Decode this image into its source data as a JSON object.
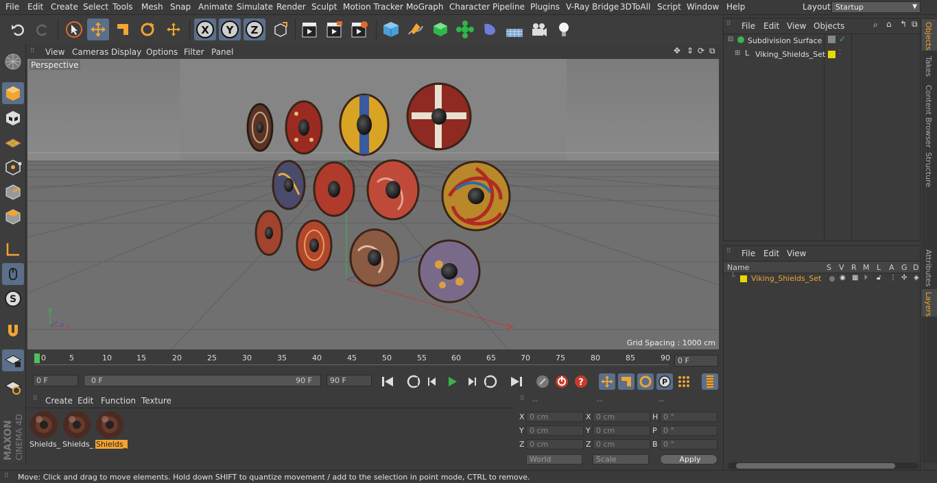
{
  "menu": [
    "File",
    "Edit",
    "Create",
    "Select",
    "Tools",
    "Mesh",
    "Snap",
    "Animate",
    "Simulate",
    "Render",
    "Sculpt",
    "Motion Tracker",
    "MoGraph",
    "Character",
    "Pipeline",
    "Plugins",
    "V-Ray Bridge",
    "3DToAll",
    "Script",
    "Window",
    "Help"
  ],
  "layout": {
    "label": "Layout:",
    "value": "Startup"
  },
  "viewport": {
    "menu": [
      "View",
      "Cameras",
      "Display",
      "Options",
      "Filter",
      "Panel"
    ],
    "label": "Perspective",
    "grid_spacing": "Grid Spacing : 1000 cm"
  },
  "timeline": {
    "ticks": [
      "0",
      "5",
      "10",
      "15",
      "20",
      "25",
      "30",
      "35",
      "40",
      "45",
      "50",
      "55",
      "60",
      "65",
      "70",
      "75",
      "80",
      "85",
      "90"
    ],
    "current_frame": "0 F"
  },
  "transport": {
    "start": "0 F",
    "range_start": "0 F",
    "range_end": "90 F",
    "end": "90 F"
  },
  "material_panel": {
    "menu": [
      "Create",
      "Edit",
      "Function",
      "Texture"
    ],
    "materials": [
      "Shields_",
      "Shields_",
      "Shields_"
    ]
  },
  "attributes": {
    "headers": [
      "--",
      "--",
      "--"
    ],
    "rows": [
      {
        "a": "X",
        "av": "0 cm",
        "b": "X",
        "bv": "0 cm",
        "c": "H",
        "cv": "0 °"
      },
      {
        "a": "Y",
        "av": "0 cm",
        "b": "Y",
        "bv": "0 cm",
        "c": "P",
        "cv": "0 °"
      },
      {
        "a": "Z",
        "av": "0 cm",
        "b": "Z",
        "bv": "0 cm",
        "c": "B",
        "cv": "0 °"
      }
    ],
    "world": "World",
    "scale": "Scale",
    "apply": "Apply"
  },
  "objects_panel": {
    "menu": [
      "File",
      "Edit",
      "View",
      "Objects"
    ],
    "items": [
      "Subdivision Surface",
      "Viking_Shields_Set"
    ]
  },
  "layers_panel": {
    "menu": [
      "File",
      "Edit",
      "View"
    ],
    "columns": [
      "Name",
      "S",
      "V",
      "R",
      "M",
      "L",
      "A",
      "G",
      "D"
    ],
    "items": [
      "Viking_Shields_Set"
    ]
  },
  "right_tabs": [
    "Objects",
    "Takes",
    "Content Browser",
    "Structure",
    "Attributes",
    "Layers"
  ],
  "branding": [
    "MAXON",
    "CINEMA 4D"
  ],
  "status": "Move: Click and drag to move elements. Hold down SHIFT to quantize movement / add to the selection in point mode, CTRL to remove.",
  "colors": {
    "accent": "#f2a531",
    "highlight": "#5b6f8a",
    "layer_yellow": "#e8d800"
  }
}
